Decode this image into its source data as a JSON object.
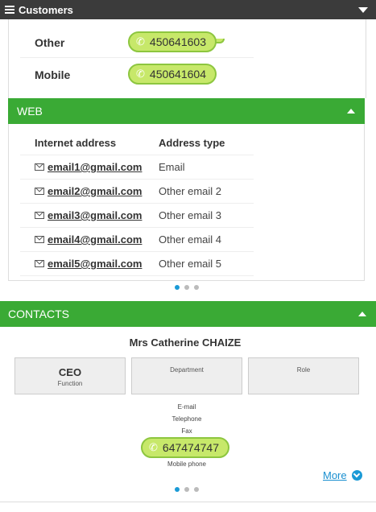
{
  "header": {
    "title": "Customers"
  },
  "phones": [
    {
      "label": "Other",
      "number": "450641603"
    },
    {
      "label": "Mobile",
      "number": "450641604"
    }
  ],
  "web": {
    "title": "WEB",
    "columns": [
      "Internet address",
      "Address type"
    ],
    "rows": [
      {
        "address": "email1@gmail.com",
        "type": "Email"
      },
      {
        "address": "email2@gmail.com",
        "type": "Other email 2"
      },
      {
        "address": "email3@gmail.com",
        "type": "Other email 3"
      },
      {
        "address": "email4@gmail.com",
        "type": "Other email 4"
      },
      {
        "address": "email5@gmail.com",
        "type": "Other email 5"
      }
    ]
  },
  "contacts": {
    "title": "CONTACTS",
    "name": "Mrs Catherine CHAIZE",
    "function_value": "CEO",
    "function_label": "Function",
    "department_label": "Department",
    "role_label": "Role",
    "email_label": "E-mail",
    "telephone_label": "Telephone",
    "fax_label": "Fax",
    "mobile_number": "647474747",
    "mobile_label": "Mobile phone",
    "more_label": "More"
  },
  "colors": {
    "section_green": "#3aaa35",
    "pill_fill": "#c7e86a",
    "pill_border": "#8dc63f",
    "accent_blue": "#1a9ad6"
  }
}
